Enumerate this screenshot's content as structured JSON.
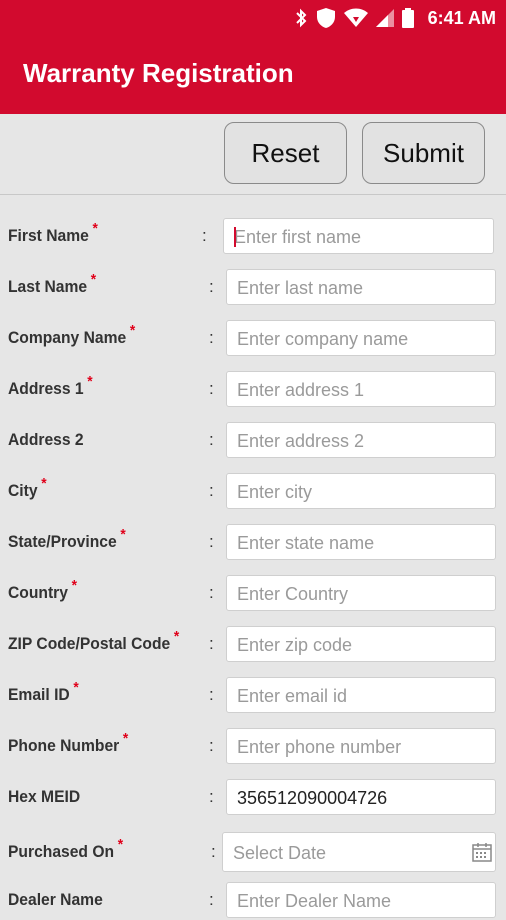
{
  "status_bar": {
    "time": "6:41 AM",
    "icons": [
      "bluetooth-icon",
      "shield-icon",
      "wifi-icon",
      "signal-icon",
      "battery-icon"
    ]
  },
  "app_bar": {
    "title": "Warranty Registration",
    "color": "#d20a2e"
  },
  "toolbar": {
    "reset_label": "Reset",
    "submit_label": "Submit"
  },
  "form": {
    "fields": [
      {
        "label": "First Name",
        "required": true,
        "placeholder": "Enter first name",
        "value": ""
      },
      {
        "label": "Last Name",
        "required": true,
        "placeholder": "Enter last name",
        "value": ""
      },
      {
        "label": "Company Name",
        "required": true,
        "placeholder": "Enter company name",
        "value": ""
      },
      {
        "label": "Address 1",
        "required": true,
        "placeholder": "Enter address 1",
        "value": ""
      },
      {
        "label": "Address 2",
        "required": false,
        "placeholder": "Enter address 2",
        "value": ""
      },
      {
        "label": "City",
        "required": true,
        "placeholder": "Enter city",
        "value": ""
      },
      {
        "label": "State/Province",
        "required": true,
        "placeholder": "Enter state name",
        "value": ""
      },
      {
        "label": "Country",
        "required": true,
        "placeholder": "Enter Country",
        "value": ""
      },
      {
        "label": "ZIP Code/Postal Code",
        "required": true,
        "placeholder": "Enter zip code",
        "value": ""
      },
      {
        "label": "Email ID",
        "required": true,
        "placeholder": "Enter email id",
        "value": ""
      },
      {
        "label": "Phone Number",
        "required": true,
        "placeholder": "Enter phone number",
        "value": ""
      },
      {
        "label": "Hex MEID",
        "required": false,
        "placeholder": "",
        "value": "356512090004726"
      },
      {
        "label": "Purchased On",
        "required": true,
        "placeholder": "Select Date",
        "value": ""
      },
      {
        "label": "Dealer Name",
        "required": false,
        "placeholder": "Enter Dealer Name",
        "value": ""
      }
    ],
    "colon": ":",
    "required_mark": "*"
  }
}
